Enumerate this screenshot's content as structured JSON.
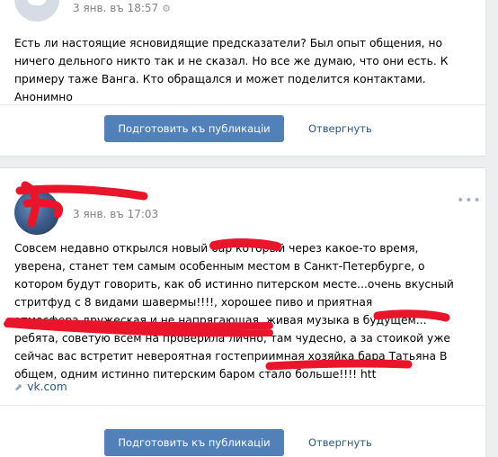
{
  "posts": [
    {
      "timestamp": "3 янв. въ 18:57",
      "time_icon": "gear-icon",
      "text": "Есть ли настоящие ясновидящие предсказатели? Был опыт общения, но ничего дельного никто так и не сказал. Но все же думаю, что они есть. К примеру таже Ванга. Кто обращался и может поделится контактами. Анонимно",
      "actions": {
        "publish_label": "Подготовить къ публикацiи",
        "reject_label": "Отвергнуть"
      }
    },
    {
      "timestamp": "3 янв. въ 17:03",
      "time_icon": "apple-icon",
      "text": "Совсем недавно открылся новый бар который через какое-то время, уверена, станет тем самым особенным местом в Санкт-Петербурге, о котором будут говорить, как об истинно питерском месте...очень вкусный стритфуд с 8 видами шавермы!!!!, хорошее пиво и приятная атмосфера,дружеская и не напрягающая, живая музыка в будущем... ребята, советую всем на проверила лично, там чудесно, а за стоикой уже сейчас вас встретит невероятная гостеприимная хозяйка бара Татьяна В общем, одним истинно питерским баром стало больше!!!! htt",
      "link": "vk.com",
      "actions": {
        "publish_label": "Подготовить къ публикацiи",
        "reject_label": "Отвергнуть"
      }
    }
  ],
  "colors": {
    "accent": "#5181b8",
    "link": "#2a5885",
    "background": "#edeef0",
    "redaction": "#e8152b"
  }
}
